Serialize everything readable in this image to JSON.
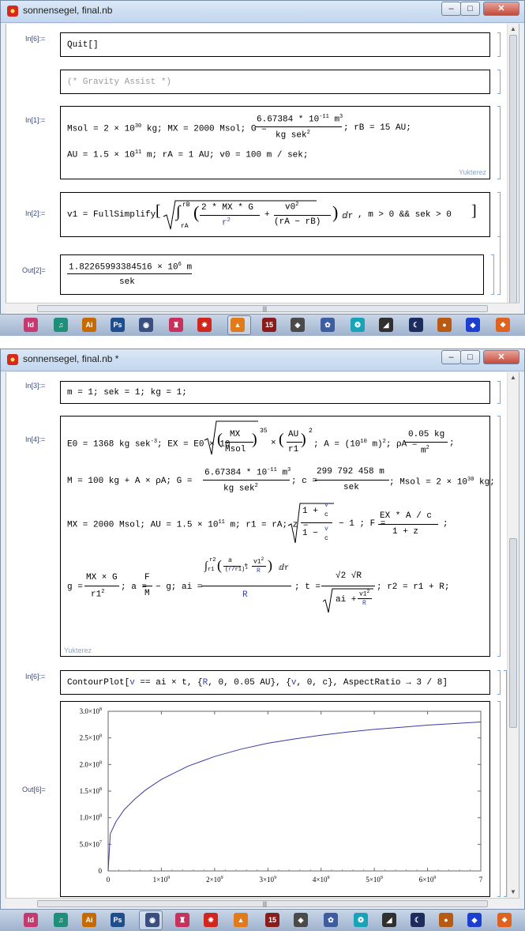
{
  "window1": {
    "title": "sonnensegel, final.nb",
    "controls": {
      "minimize": "–",
      "maximize": "□",
      "close": "✕"
    },
    "cells": [
      {
        "label": "In[6]:=",
        "text": "Quit[]"
      },
      {
        "label": "",
        "text": "(* Gravity Assist *)"
      },
      {
        "label": "In[1]:=",
        "line1_a": "Msol = 2 × 10",
        "line1_exp": "30",
        "line1_b": "kg; MX = 2000 Msol; G =",
        "g_num": "6.67384 * 10",
        "g_num_exp": "-11",
        "g_num_unit": "m",
        "g_num_unit_exp": "3",
        "g_den": "kg sek",
        "g_den_exp": "2",
        "line1_c": "; rB = 15 AU;",
        "line2_a": "AU = 1.5 × 10",
        "line2_exp": "11",
        "line2_b": "m;  rA = 1 AU; v0 = 100 m / sek;",
        "watermark": "Yukterez"
      },
      {
        "label": "In[2]:=",
        "prefix": "v1 = FullSimplify",
        "int_upper": "rB",
        "int_lower": "rA",
        "frac1_num": "2 * MX * G",
        "frac1_den": "r",
        "frac1_den_exp": "2",
        "plus": "+",
        "frac2_num": "v0",
        "frac2_num_exp": "2",
        "frac2_den": "(rA − rB)",
        "dr": "ⅆr",
        "suffix": ",  m > 0 && sek > 0"
      },
      {
        "label": "Out[2]=",
        "num": "1.82265993384516 × 10",
        "num_exp": "6",
        "num_unit": "m",
        "den": "sek"
      }
    ]
  },
  "window2": {
    "title": "sonnensegel, final.nb *",
    "controls": {
      "minimize": "–",
      "maximize": "□",
      "close": "✕"
    },
    "cells": [
      {
        "label": "In[3]:=",
        "text": "m = 1; sek = 1; kg = 1;"
      },
      {
        "label": "In[4]:=",
        "l1": {
          "a": "E0 = 1368 kg sek",
          "a_exp": "-3",
          "b": "; EX = E0 × 10",
          "frac_num": "MX",
          "frac_den": "Msol",
          "frac_exp": "35",
          "times": "×",
          "frac2_num": "AU",
          "frac2_den": "r1",
          "frac2_exp": "2",
          "c": "; A = (10",
          "c_exp": "10",
          "d": "m)",
          "d_exp": "2",
          "e": "; ρA =",
          "rho_num": "0.05 kg",
          "rho_den": "m",
          "rho_den_exp": "2",
          "f": ";"
        },
        "l2": {
          "a": "M = 100 kg + A × ρA; G =",
          "g_num": "6.67384 * 10",
          "g_num_exp": "-11",
          "g_num_unit": "m",
          "g_num_unit_exp": "3",
          "g_den": "kg sek",
          "g_den_exp": "2",
          "b": "; c =",
          "c_num": "299 792 458 m",
          "c_den": "sek",
          "d": "; Msol = 2 × 10",
          "d_exp": "30",
          "e": "kg;"
        },
        "l3": {
          "a": "MX = 2000 Msol;  AU = 1.5 × 10",
          "a_exp": "11",
          "b": "m; r1 = rA; z =",
          "z_top": "1 +",
          "z_bottom": "1 −",
          "v": "v",
          "c": "c",
          "z_tail": "− 1 ; F =",
          "f_num": "EX * A / c",
          "f_den": "1 + z",
          "e": ";"
        },
        "l4": {
          "a": "g =",
          "g_num": "MX × G",
          "g_den": "r1",
          "g_den_exp": "2",
          "b": "; a =",
          "a_num": "F",
          "a_den": "M",
          "c": "− g; ai =",
          "int_upper": "r2",
          "int_lower": "r1",
          "ai_inner_a": "a",
          "ai_inner_r": "r",
          "ai_inner_r1": "r1",
          "ai_plus": "+",
          "ai_v": "v1",
          "ai_v_exp": "2",
          "ai_R": "R",
          "ai_dr": "ⅆr",
          "ai_den": "R",
          "d": "; t =",
          "t_num": "√2 √R",
          "t_den_a": "ai +",
          "t_den_v": "v1",
          "t_den_exp": "2",
          "t_den_R": "R",
          "e": ";  r2 = r1 + R;"
        },
        "watermark": "Yukterez"
      },
      {
        "label": "In[6]:=",
        "text_a": "ContourPlot[",
        "v": "v",
        "text_b": " == ai × t,  {",
        "R": "R",
        "text_c": ", 0, 0.05 AU}, {",
        "v2": "v",
        "text_d": ", 0, c},  AspectRatio → 3 / 8]"
      },
      {
        "label": "Out[6]="
      }
    ]
  },
  "chart_data": {
    "type": "line",
    "title": "",
    "xlabel": "",
    "ylabel": "",
    "xlim": [
      0,
      7000000000
    ],
    "ylim": [
      0,
      300000000
    ],
    "x_ticks": [
      {
        "v": 0,
        "label": "0"
      },
      {
        "v": 1000000000,
        "label": "1×10",
        "exp": "9"
      },
      {
        "v": 2000000000,
        "label": "2×10",
        "exp": "9"
      },
      {
        "v": 3000000000,
        "label": "3×10",
        "exp": "9"
      },
      {
        "v": 4000000000,
        "label": "4×10",
        "exp": "9"
      },
      {
        "v": 5000000000,
        "label": "5×10",
        "exp": "9"
      },
      {
        "v": 6000000000,
        "label": "6×10",
        "exp": "9"
      },
      {
        "v": 7000000000,
        "label": "7",
        "exp": ""
      }
    ],
    "y_ticks": [
      {
        "v": 0,
        "label": "0"
      },
      {
        "v": 50000000,
        "label": "5.0×10",
        "exp": "7"
      },
      {
        "v": 100000000,
        "label": "1.0×10",
        "exp": "8"
      },
      {
        "v": 150000000,
        "label": "1.5×10",
        "exp": "8"
      },
      {
        "v": 200000000,
        "label": "2.0×10",
        "exp": "8"
      },
      {
        "v": 250000000,
        "label": "2.5×10",
        "exp": "8"
      },
      {
        "v": 300000000,
        "label": "3.0×10",
        "exp": "8"
      }
    ],
    "series": [
      {
        "color": "#3b3ba0",
        "x": [
          0,
          40000000,
          150000000,
          300000000,
          500000000,
          700000000,
          1000000000,
          1500000000,
          2000000000,
          2500000000,
          3000000000,
          3500000000,
          4000000000,
          4500000000,
          5000000000,
          5500000000,
          6000000000,
          6500000000,
          7000000000
        ],
        "y": [
          0,
          70000000,
          93000000,
          115000000,
          135000000,
          152000000,
          172000000,
          197000000,
          215000000,
          229000000,
          240000000,
          248000000,
          255000000,
          261000000,
          266000000,
          270000000,
          274000000,
          277000000,
          280000000
        ]
      }
    ]
  },
  "taskbar": {
    "icons": [
      {
        "name": "indesign",
        "text": "Id",
        "color": "#c43a6e"
      },
      {
        "name": "audition",
        "text": "♫",
        "color": "#1f8f7a"
      },
      {
        "name": "illustrator",
        "text": "Ai",
        "color": "#c66a00"
      },
      {
        "name": "photoshop",
        "text": "Ps",
        "color": "#1f4e8f"
      },
      {
        "name": "cinema4d",
        "text": "◉",
        "color": "#3a4f7f"
      },
      {
        "name": "flash",
        "text": "♜",
        "color": "#c7315e"
      },
      {
        "name": "mathematica",
        "text": "✸",
        "color": "#d0261d"
      },
      {
        "name": "matlab",
        "text": "▲",
        "color": "#e07a1a"
      },
      {
        "name": "calendar15",
        "text": "15",
        "color": "#8b1c1c"
      },
      {
        "name": "tool-a",
        "text": "◈",
        "color": "#4a4a4a"
      },
      {
        "name": "tool-b",
        "text": "✿",
        "color": "#3d5da0"
      },
      {
        "name": "tool-c",
        "text": "❂",
        "color": "#19a3b8"
      },
      {
        "name": "tool-d",
        "text": "◢",
        "color": "#303030"
      },
      {
        "name": "celestia",
        "text": "☾",
        "color": "#1c2c5c"
      },
      {
        "name": "planet",
        "text": "●",
        "color": "#b85a12"
      },
      {
        "name": "gem",
        "text": "◆",
        "color": "#1d3fd0"
      },
      {
        "name": "firefox",
        "text": "❖",
        "color": "#e0621f"
      }
    ]
  }
}
